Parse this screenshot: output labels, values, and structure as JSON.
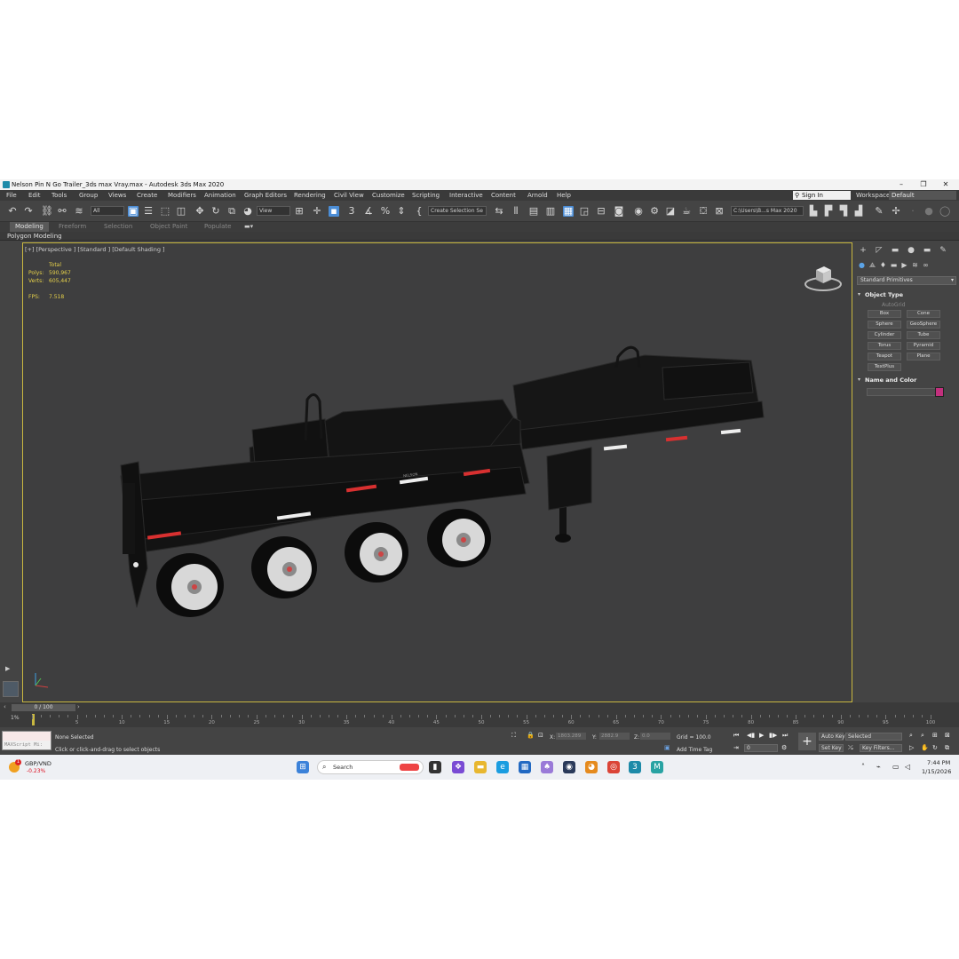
{
  "window": {
    "title": "Nelson Pin N Go Trailer_3ds max Vray.max - Autodesk 3ds Max 2020",
    "minimize": "–",
    "restore": "❐",
    "close": "✕"
  },
  "menu": {
    "items": [
      "File",
      "Edit",
      "Tools",
      "Group",
      "Views",
      "Create",
      "Modifiers",
      "Animation",
      "Graph Editors",
      "Rendering",
      "Civil View",
      "Customize",
      "Scripting",
      "Interactive",
      "Content",
      "Arnold",
      "Help"
    ],
    "sign_in": "Sign In",
    "workspaces_label": "Workspaces:",
    "workspace_value": "Default"
  },
  "toolbar": {
    "filter_value": "All",
    "coord_value": "View",
    "selection_set_placeholder": "Create Selection Se",
    "snap_value": "3",
    "path_value": "C:\\Users\\B...s Max 2020"
  },
  "ribbon": {
    "tabs": [
      "Modeling",
      "Freeform",
      "Selection",
      "Object Paint",
      "Populate"
    ],
    "sub_label": "Polygon Modeling"
  },
  "viewport": {
    "label": "[+] [Perspective ] [Standard ] [Default Shading ]",
    "stats": {
      "total_label": "Total",
      "polys_label": "Polys:",
      "polys_value": "590,967",
      "verts_label": "Verts:",
      "verts_value": "605,447",
      "fps_label": "FPS:",
      "fps_value": "7.518"
    },
    "decal_text": "NELSON",
    "colors": {
      "accent": "#c9b840",
      "stats": "#e5d04a"
    }
  },
  "command_panel": {
    "category": "Standard Primitives",
    "object_type_label": "Object Type",
    "autogrid_label": "AutoGrid",
    "primitives": [
      "Box",
      "Cone",
      "Sphere",
      "GeoSphere",
      "Cylinder",
      "Tube",
      "Torus",
      "Pyramid",
      "Teapot",
      "Plane",
      "TextPlus"
    ],
    "name_color_label": "Name and Color",
    "object_color": "#c2307d"
  },
  "timeline": {
    "frame_display": "0 / 100",
    "percent": "1%",
    "ticks": [
      "5",
      "10",
      "15",
      "20",
      "25",
      "30",
      "35",
      "40",
      "45",
      "50",
      "55",
      "60",
      "65",
      "70",
      "75",
      "80",
      "85",
      "90",
      "95",
      "100"
    ]
  },
  "status": {
    "maxscript_label": "MAXScript Mi:",
    "selection_status": "None Selected",
    "prompt": "Click or click-and-drag to select objects",
    "x_label": "X:",
    "x_value": "1803.289",
    "y_label": "Y:",
    "y_value": "2882.9",
    "z_label": "Z:",
    "z_value": "0.0",
    "grid": "Grid = 100.0",
    "add_time_tag": "Add Time Tag",
    "auto_key": "Auto Key",
    "selected_value": "Selected",
    "set_key": "Set Key",
    "key_filters": "Key Filters...",
    "frame_value": "0"
  },
  "taskbar": {
    "weather_badge": "1",
    "currency": "GBP/VND",
    "change": "-0.23%",
    "search_placeholder": "Search",
    "time": "7:44 PM",
    "date": "1/15/2026"
  }
}
